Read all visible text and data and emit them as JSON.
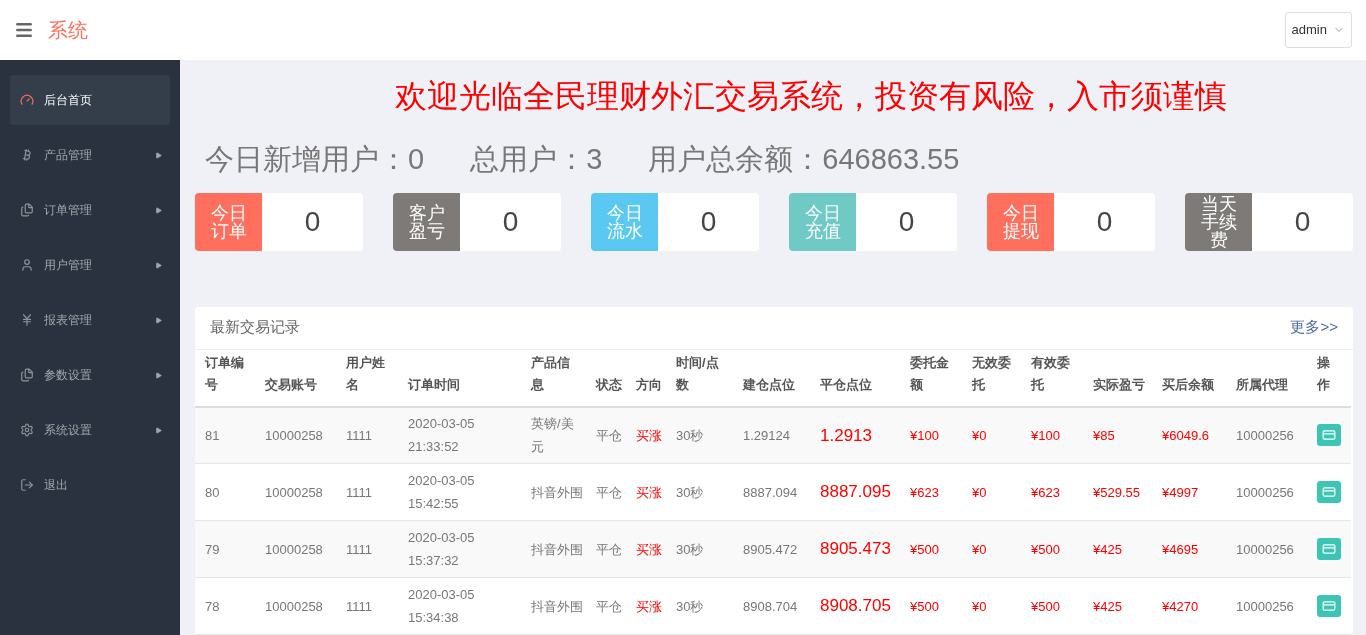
{
  "header": {
    "title": "系统",
    "user": "admin"
  },
  "sidebar": [
    {
      "label": "后台首页",
      "selected": true,
      "arrow": false
    },
    {
      "label": "产品管理",
      "selected": false,
      "arrow": true
    },
    {
      "label": "订单管理",
      "selected": false,
      "arrow": true
    },
    {
      "label": "用户管理",
      "selected": false,
      "arrow": true
    },
    {
      "label": "报表管理",
      "selected": false,
      "arrow": true
    },
    {
      "label": "参数设置",
      "selected": false,
      "arrow": true
    },
    {
      "label": "系统设置",
      "selected": false,
      "arrow": true
    },
    {
      "label": "退出",
      "selected": false,
      "arrow": false
    }
  ],
  "banner": "欢迎光临全民理财外汇交易系统，投资有风险，入市须谨慎",
  "summary": [
    "今日新增用户：0",
    "总用户：3",
    "用户总余额：646863.55"
  ],
  "stats": [
    {
      "label": "今日订单",
      "value": "0",
      "color": "#fe6f5e"
    },
    {
      "label": "客户盈亏",
      "value": "0",
      "color": "#7d7a77"
    },
    {
      "label": "今日流水",
      "value": "0",
      "color": "#5bc8f2"
    },
    {
      "label": "今日充值",
      "value": "0",
      "color": "#6fcac6"
    },
    {
      "label": "今日提现",
      "value": "0",
      "color": "#fe6f5e"
    },
    {
      "label": "当天手续费",
      "value": "0",
      "color": "#7d7a77"
    }
  ],
  "table": {
    "title": "最新交易记录",
    "more": "更多>>",
    "columns": [
      {
        "label": "订单编号",
        "kind": "text"
      },
      {
        "label": "交易账号",
        "kind": "text"
      },
      {
        "label": "用户姓名",
        "kind": "text"
      },
      {
        "label": "订单时间",
        "kind": "text"
      },
      {
        "label": "产品信息",
        "kind": "text"
      },
      {
        "label": "状态",
        "kind": "text"
      },
      {
        "label": "方向",
        "kind": "red"
      },
      {
        "label": "时间/点数",
        "kind": "text"
      },
      {
        "label": "建仓点位",
        "kind": "text"
      },
      {
        "label": "平仓点位",
        "kind": "price"
      },
      {
        "label": "委托金额",
        "kind": "red"
      },
      {
        "label": "无效委托",
        "kind": "red"
      },
      {
        "label": "有效委托",
        "kind": "red"
      },
      {
        "label": "实际盈亏",
        "kind": "red"
      },
      {
        "label": "买后余额",
        "kind": "red"
      },
      {
        "label": "所属代理",
        "kind": "text"
      },
      {
        "label": "操作",
        "kind": "action"
      }
    ],
    "rows": [
      [
        "81",
        "10000258",
        "1111",
        "2020-03-05 21:33:52",
        "英镑/美元",
        "平仓",
        "买涨",
        "30秒",
        "1.29124",
        "1.2913",
        "¥100",
        "¥0",
        "¥100",
        "¥85",
        "¥6049.6",
        "10000256",
        ""
      ],
      [
        "80",
        "10000258",
        "1111",
        "2020-03-05 15:42:55",
        "抖音外围",
        "平仓",
        "买涨",
        "30秒",
        "8887.094",
        "8887.095",
        "¥623",
        "¥0",
        "¥623",
        "¥529.55",
        "¥4997",
        "10000256",
        ""
      ],
      [
        "79",
        "10000258",
        "1111",
        "2020-03-05 15:37:32",
        "抖音外围",
        "平仓",
        "买涨",
        "30秒",
        "8905.472",
        "8905.473",
        "¥500",
        "¥0",
        "¥500",
        "¥425",
        "¥4695",
        "10000256",
        ""
      ],
      [
        "78",
        "10000258",
        "1111",
        "2020-03-05 15:34:38",
        "抖音外围",
        "平仓",
        "买涨",
        "30秒",
        "8908.704",
        "8908.705",
        "¥500",
        "¥0",
        "¥500",
        "¥425",
        "¥4270",
        "10000256",
        ""
      ]
    ]
  }
}
